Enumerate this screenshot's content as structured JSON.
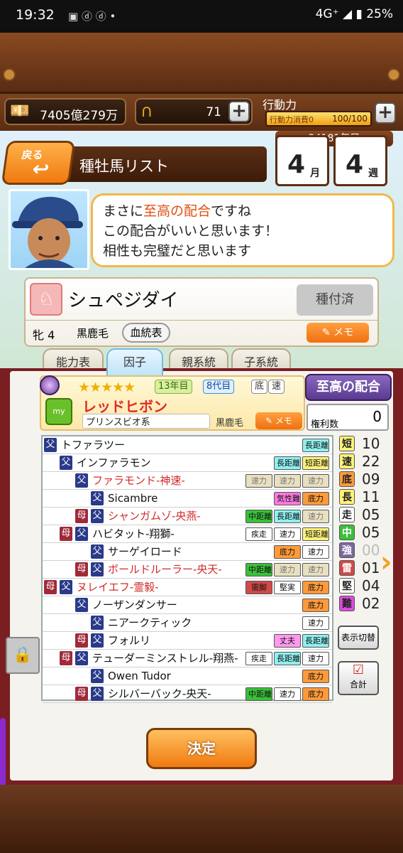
{
  "status": {
    "time": "19:32",
    "right": "4G⁺ ◢ ▮ 25%"
  },
  "resources": {
    "money": "7405億279万",
    "horseshoe": "71",
    "action_label": "行動力",
    "action_sub": "行動力消費0",
    "action_value": "100/100"
  },
  "header": {
    "back": "戻る",
    "title": "種牡馬リスト",
    "year": "24181年目",
    "month": "4",
    "month_unit": "月",
    "week": "4",
    "week_unit": "週"
  },
  "speech": {
    "line1_pre": "まさに",
    "line1_hl": "至高の配合",
    "line1_post": "ですね",
    "line2": "この配合がいいと思います！",
    "line3": "相性も完璧だと思います"
  },
  "mare": {
    "name": "シュペジダイ",
    "status": "種付済",
    "sex_age": "牝 4",
    "coat": "黒鹿毛",
    "pedigree_btn": "血統表",
    "memo": "メモ"
  },
  "tabs": [
    "能力表",
    "因子",
    "親系統",
    "子系統"
  ],
  "stallion": {
    "year": "13年目",
    "gen": "8代目",
    "tag1": "底",
    "tag2": "速",
    "name": "レッドヒボン",
    "line": "プリンスビオ系",
    "coat": "黒鹿毛",
    "memo": "メモ",
    "match": "至高の配合",
    "rights_label": "権利数",
    "rights": "0"
  },
  "pedigree": [
    {
      "g1": "父",
      "name": "トファラツー",
      "tags": [
        "長距離"
      ],
      "red": false
    },
    {
      "g2": "父",
      "name": "インファラモン",
      "tags": [
        "長距離",
        "短距離"
      ],
      "red": false
    },
    {
      "g3": "父",
      "name": "ファラモンド-神速-",
      "tags": [
        "速力",
        "速力",
        "速力"
      ],
      "red": true
    },
    {
      "g4": "父",
      "name": "Sicambre",
      "tags": [
        "気性難",
        "底力"
      ],
      "red": false
    },
    {
      "g3": "母",
      "g4": "父",
      "name": "シャンガムゾ-央燕-",
      "tags": [
        "中距離",
        "長距離",
        "速力"
      ],
      "red": true
    },
    {
      "g2": "母",
      "g3": "父",
      "name": "ハビタット-翔獅-",
      "tags": [
        "疾走",
        "速力",
        "短距離"
      ],
      "red": false
    },
    {
      "g4": "父",
      "name": "サーゲイロード",
      "tags": [
        "底力",
        "速力"
      ],
      "red": false
    },
    {
      "g3": "母",
      "g4": "父",
      "name": "ボールドルーラー-央天-",
      "tags": [
        "中距離",
        "速力",
        "速力"
      ],
      "red": true
    },
    {
      "g1": "母",
      "g2": "父",
      "name": "ヌレイエフ-霊毅-",
      "tags": [
        "需脚",
        "堅実",
        "底力"
      ],
      "red": true
    },
    {
      "g3": "父",
      "name": "ノーザンダンサー",
      "tags": [
        "底力"
      ],
      "red": false
    },
    {
      "g4": "父",
      "name": "ニアークティック",
      "tags": [
        "速力"
      ],
      "red": false
    },
    {
      "g3": "母",
      "g4": "父",
      "name": "フォルリ",
      "tags": [
        "丈夫",
        "長距離"
      ],
      "red": false
    },
    {
      "g2": "母",
      "g3": "父",
      "name": "テューダーミンストレル-翔燕-",
      "tags": [
        "疾走",
        "長距離",
        "速力"
      ],
      "red": false
    },
    {
      "g4": "父",
      "name": "Owen Tudor",
      "tags": [
        "底力"
      ],
      "red": false
    },
    {
      "g3": "母",
      "g4": "父",
      "name": "シルバーバック-央天-",
      "tags": [
        "中距離",
        "速力",
        "底力"
      ],
      "red": false
    }
  ],
  "stats": [
    {
      "k": "短",
      "v": "10",
      "c": "#fff27a"
    },
    {
      "k": "速",
      "v": "22",
      "c": "#fff27a"
    },
    {
      "k": "底",
      "v": "09",
      "c": "#ff9a3a"
    },
    {
      "k": "長",
      "v": "11",
      "c": "#fff27a"
    },
    {
      "k": "走",
      "v": "05",
      "c": "#ffffff"
    },
    {
      "k": "中",
      "v": "05",
      "c": "#3ac03a"
    },
    {
      "k": "強",
      "v": "00",
      "c": "#7a6aa0"
    },
    {
      "k": "雷",
      "v": "01",
      "c": "#d04a4a"
    },
    {
      "k": "堅",
      "v": "04",
      "c": "#ffffff"
    },
    {
      "k": "難",
      "v": "02",
      "c": "#e04ae0"
    }
  ],
  "buttons": {
    "toggle": "表示切替",
    "total": "合計",
    "decide": "決定"
  }
}
